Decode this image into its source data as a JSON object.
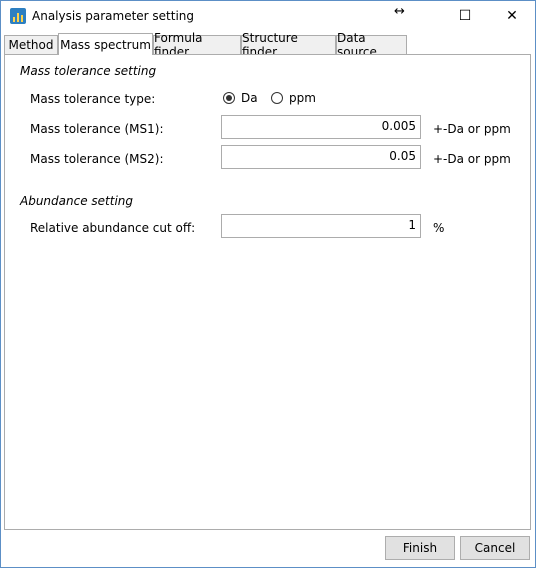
{
  "window": {
    "title": "Analysis parameter setting",
    "resize_glyph": "↔",
    "maximize_glyph": "☐",
    "close_glyph": "✕"
  },
  "tabs": [
    {
      "label": "Method"
    },
    {
      "label": "Mass spectrum",
      "active": true
    },
    {
      "label": "Formula finder"
    },
    {
      "label": "Structure finder"
    },
    {
      "label": "Data source"
    }
  ],
  "mass_tolerance": {
    "section_title": "Mass tolerance setting",
    "type_label": "Mass tolerance type:",
    "options": [
      {
        "label": "Da",
        "selected": true
      },
      {
        "label": "ppm",
        "selected": false
      }
    ],
    "ms1_label": "Mass tolerance (MS1):",
    "ms1_value": "0.005",
    "ms1_unit": "+-Da or ppm",
    "ms2_label": "Mass tolerance (MS2):",
    "ms2_value": "0.05",
    "ms2_unit": "+-Da or ppm"
  },
  "abundance": {
    "section_title": "Abundance setting",
    "cutoff_label": "Relative abundance cut off:",
    "cutoff_value": "1",
    "cutoff_unit": "%"
  },
  "footer": {
    "finish_label": "Finish",
    "cancel_label": "Cancel"
  },
  "colors": {
    "window_border": "#5c8fc6",
    "tab_border": "#acacac",
    "button_bg": "#e1e1e1"
  }
}
